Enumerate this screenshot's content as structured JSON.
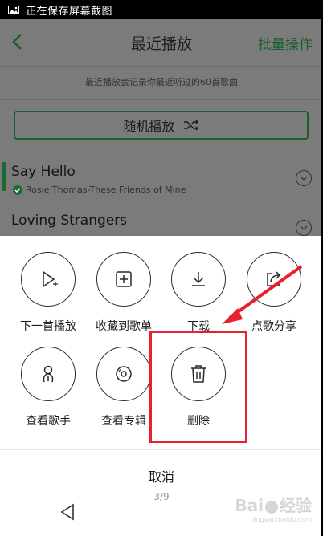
{
  "status_bar": {
    "text": "正在保存屏幕截图",
    "icon": "image-icon"
  },
  "header": {
    "title": "最近播放",
    "batch_label": "批量操作",
    "back_icon": "chevron-left-icon"
  },
  "hint": "最近播放会记录你最近听过的60首歌曲",
  "shuffle": {
    "label": "随机播放",
    "icon": "shuffle-icon"
  },
  "songs": [
    {
      "title": "Say Hello",
      "subtitle": "Rosie Thomas-These Friends of Mine",
      "playing": true
    },
    {
      "title": "Loving Strangers",
      "subtitle": "",
      "playing": false
    }
  ],
  "sheet": {
    "actions": [
      {
        "label": "下一首播放",
        "icon": "play-next-icon"
      },
      {
        "label": "收藏到歌单",
        "icon": "add-to-playlist-icon"
      },
      {
        "label": "下载",
        "icon": "download-icon"
      },
      {
        "label": "点歌分享",
        "icon": "share-icon"
      },
      {
        "label": "查看歌手",
        "icon": "singer-icon"
      },
      {
        "label": "查看专辑",
        "icon": "album-icon"
      },
      {
        "label": "删除",
        "icon": "trash-icon"
      }
    ],
    "cancel_label": "取消",
    "pager": "3/9"
  },
  "watermark": {
    "text": "Bai",
    "text2": "经验",
    "small": "jingyan.baidu.com"
  },
  "colors": {
    "accent": "#1c6a33",
    "annotation": "#e8202b"
  }
}
